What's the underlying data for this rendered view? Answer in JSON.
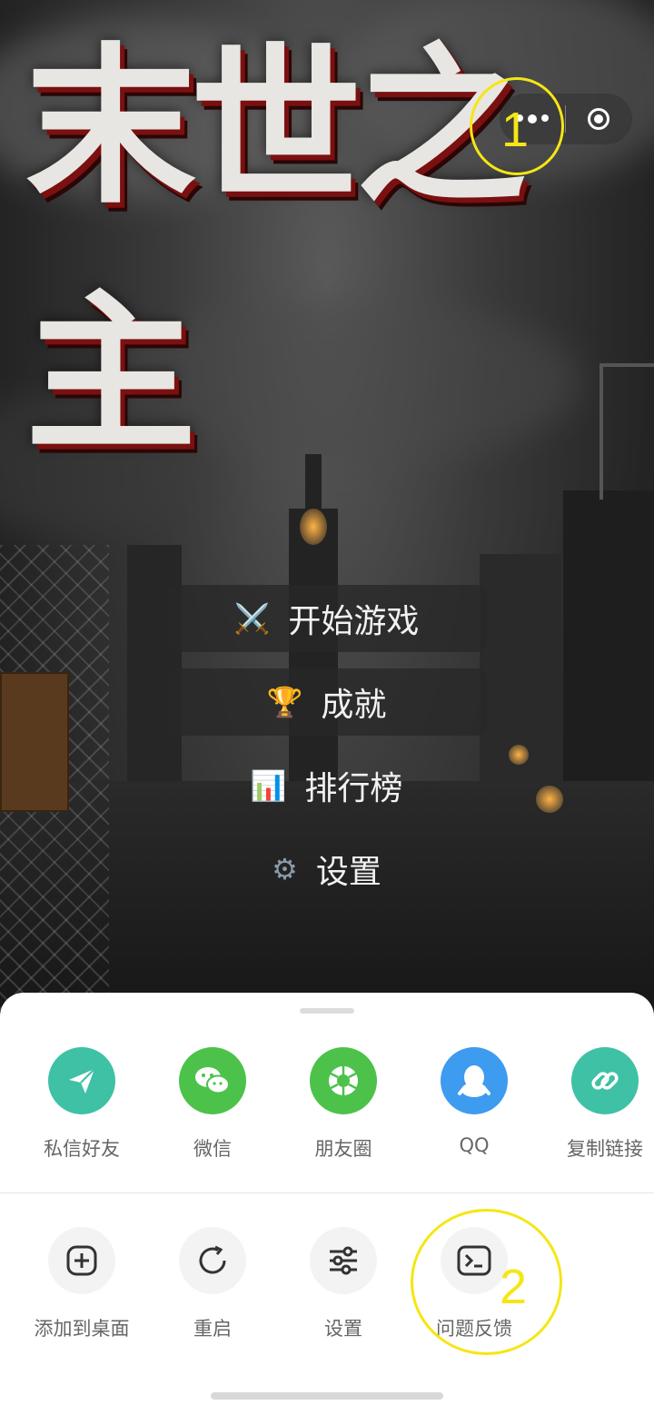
{
  "game": {
    "title": "末世之主",
    "menu": [
      {
        "icon": "⚔️",
        "label": "开始游戏"
      },
      {
        "icon": "🏆",
        "label": "成就"
      },
      {
        "icon": "📊",
        "label": "排行榜"
      },
      {
        "icon": "⚙",
        "label": "设置"
      }
    ]
  },
  "capsule": {
    "more_icon": "more-dots-icon",
    "close_icon": "close-circle-icon"
  },
  "annotations": {
    "marker1": "1",
    "marker2": "2",
    "color": "#f5e614"
  },
  "sheet": {
    "share": [
      {
        "label": "私信好友",
        "icon": "paper-plane-icon",
        "color": "#3fc1a5"
      },
      {
        "label": "微信",
        "icon": "wechat-icon",
        "color": "#4cc24a"
      },
      {
        "label": "朋友圈",
        "icon": "moments-icon",
        "color": "#4cc24a"
      },
      {
        "label": "QQ",
        "icon": "qq-icon",
        "color": "#3d9bf0"
      },
      {
        "label": "复制链接",
        "icon": "link-icon",
        "color": "#3fc1a5"
      }
    ],
    "utils": [
      {
        "label": "添加到桌面",
        "icon": "add-square-icon"
      },
      {
        "label": "重启",
        "icon": "restart-icon"
      },
      {
        "label": "设置",
        "icon": "sliders-icon"
      },
      {
        "label": "问题反馈",
        "icon": "terminal-icon"
      }
    ]
  }
}
